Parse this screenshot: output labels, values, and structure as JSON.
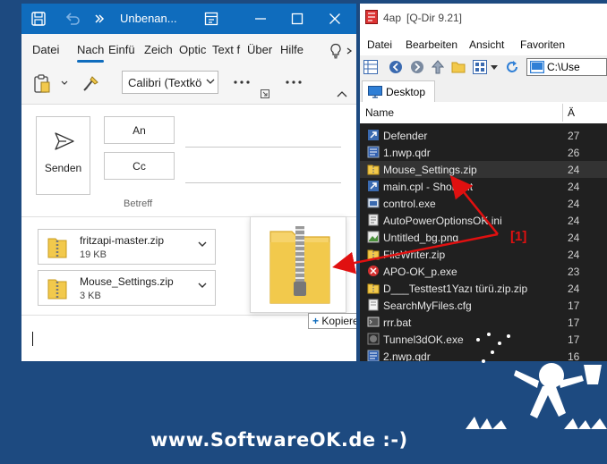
{
  "outlook": {
    "title": "Unbenan...",
    "menu": [
      "Datei",
      "Nach",
      "Einfü",
      "Zeich",
      "Optic",
      "Text f",
      "Über",
      "Hilfe"
    ],
    "font": "Calibri (Textkö",
    "send_label": "Senden",
    "to_label": "An",
    "cc_label": "Cc",
    "subject_label": "Betreff",
    "attachments": [
      {
        "name": "fritzapi-master.zip",
        "size": "19 KB"
      },
      {
        "name": "Mouse_Settings.zip",
        "size": "3 KB"
      }
    ],
    "copy_badge": "Kopieren"
  },
  "qdir": {
    "title": "4ap",
    "app_name": "[Q-Dir 9.21]",
    "menu": [
      "Datei",
      "Bearbeiten",
      "Ansicht",
      "Favoriten"
    ],
    "address": "C:\\Use",
    "tab": "Desktop",
    "col_name": "Name",
    "col_date": "Ä",
    "files": [
      {
        "name": "Defender",
        "date": "27",
        "icon": "shortcut"
      },
      {
        "name": "1.nwp.qdr",
        "date": "26",
        "icon": "qdr"
      },
      {
        "name": "Mouse_Settings.zip",
        "date": "24",
        "icon": "zip",
        "selected": true
      },
      {
        "name": "main.cpl - Shortcut",
        "date": "24",
        "icon": "shortcut"
      },
      {
        "name": "control.exe",
        "date": "24",
        "icon": "exe"
      },
      {
        "name": "AutoPowerOptionsOK.ini",
        "date": "24",
        "icon": "ini"
      },
      {
        "name": "Untitled_bg.png",
        "date": "24",
        "icon": "png"
      },
      {
        "name": "FileWriter.zip",
        "date": "24",
        "icon": "zip"
      },
      {
        "name": "APO-OK_p.exe",
        "date": "23",
        "icon": "exe-red"
      },
      {
        "name": "D___Testtest1Yazı türü.zip.zip",
        "date": "24",
        "icon": "zip"
      },
      {
        "name": "SearchMyFiles.cfg",
        "date": "17",
        "icon": "cfg"
      },
      {
        "name": "rrr.bat",
        "date": "17",
        "icon": "bat"
      },
      {
        "name": "Tunnel3dOK.exe",
        "date": "17",
        "icon": "img"
      },
      {
        "name": "2.nwp.qdr",
        "date": "16",
        "icon": "qdr"
      }
    ]
  },
  "annotation": {
    "step": "[1]",
    "arrow_color": "#e01010"
  },
  "watermark": "www.SoftwareOK.de :-)",
  "colors": {
    "outlook_accent": "#0f6cbd",
    "background": "#1d4a80",
    "list_bg": "#202020",
    "folder": "#f2c94c"
  }
}
